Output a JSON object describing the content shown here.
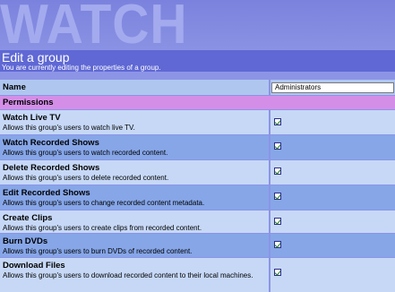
{
  "banner": {
    "logo_text": "WATCH"
  },
  "header": {
    "title": "Edit a group",
    "subtitle": "You are currently editing the properties of a group."
  },
  "name_field": {
    "label": "Name",
    "value": "Administrators"
  },
  "permissions_header": "Permissions",
  "permissions": [
    {
      "label": "Watch Live TV",
      "description": "Allows this group's users to watch live TV.",
      "checked": true
    },
    {
      "label": "Watch Recorded Shows",
      "description": "Allows this group's users to watch recorded content.",
      "checked": true
    },
    {
      "label": "Delete Recorded Shows",
      "description": "Allows this group's users to delete recorded content.",
      "checked": true
    },
    {
      "label": "Edit Recorded Shows",
      "description": "Allows this group's users to change recorded content metadata.",
      "checked": true
    },
    {
      "label": "Create Clips",
      "description": "Allows this group's users to create clips from recorded content.",
      "checked": true
    },
    {
      "label": "Burn DVDs",
      "description": "Allows this group's users to burn DVDs of recorded content.",
      "checked": true
    },
    {
      "label": "Download Files",
      "description": "Allows this group's users to download recorded content to their local machines.",
      "checked": true
    }
  ]
}
